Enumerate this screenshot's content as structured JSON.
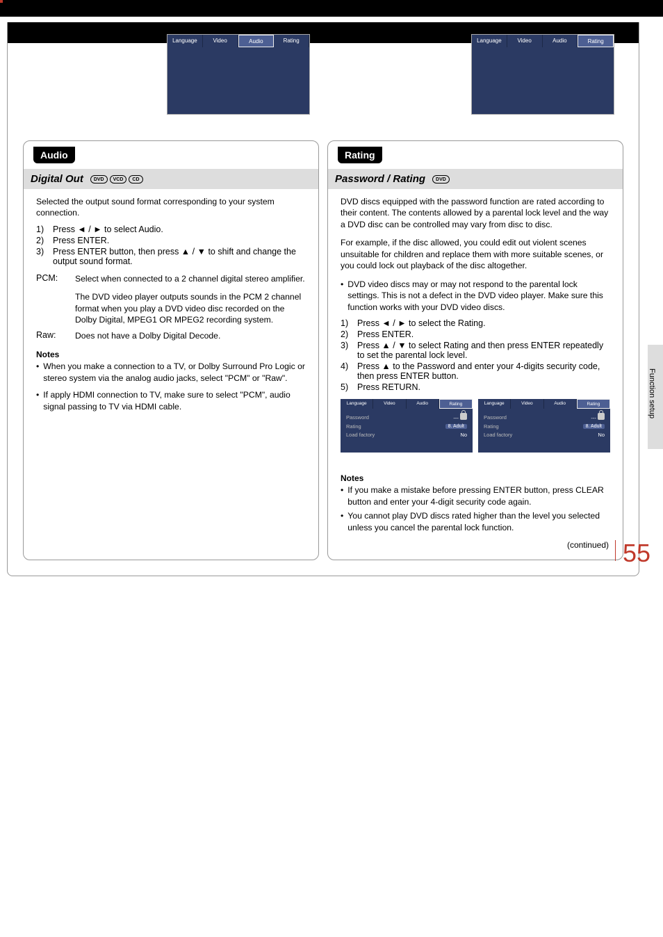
{
  "sideTab": "Function setup",
  "pageNumber": "55",
  "tabs": [
    "Language",
    "Video",
    "Audio",
    "Rating"
  ],
  "left": {
    "sectionTab": "Audio",
    "activeTabIndex": 2,
    "banner": {
      "title": "Digital Out",
      "media": [
        "DVD",
        "VCD",
        "CD"
      ]
    },
    "intro": "Selected the output sound format corresponding to your system connection.",
    "steps": [
      "Press ◄ / ► to select Audio.",
      "Press ENTER.",
      "Press ENTER button, then press ▲ / ▼ to shift and change the output sound format."
    ],
    "kv": [
      {
        "k": "PCM:",
        "v1": "Select when connected to a 2 channel digital stereo amplifier.",
        "v2": "The DVD video player outputs sounds in the PCM 2 channel format when you play a DVD video disc recorded on the Dolby Digital, MPEG1 OR MPEG2 recording system."
      },
      {
        "k": "Raw:",
        "v1": "Does not have a Dolby Digital Decode."
      }
    ],
    "notesTitle": "Notes",
    "notes": [
      "When you make a connection to a TV, or Dolby Surround Pro Logic or stereo system via the analog audio jacks, select \"PCM\" or \"Raw\".",
      "If apply HDMI connection to TV, make sure to select \"PCM\", audio signal passing to TV via HDMI cable."
    ]
  },
  "right": {
    "sectionTab": "Rating",
    "activeTabIndex": 3,
    "banner": {
      "title": "Password / Rating",
      "media": [
        "DVD"
      ]
    },
    "para1": "DVD discs equipped with the password function are rated according to their content. The contents allowed by a parental lock level and the way a DVD disc can be controlled may vary from disc to disc.",
    "para2": "For example, if the disc allowed, you could edit out violent scenes unsuitable for children and replace them with more suitable scenes, or you could lock out playback of the disc altogether.",
    "bullet": "DVD video discs may or may not respond to the parental lock settings. This is not a defect in the DVD video player. Make sure this function works with your DVD video discs.",
    "steps": [
      "Press ◄ / ► to select the Rating.",
      "Press ENTER.",
      "Press ▲ / ▼ to select Rating and then press ENTER repeatedly to set the parental lock level.",
      "Press ▲ to the Password and enter your 4-digits security code, then press ENTER button.",
      "Press RETURN."
    ],
    "osd": {
      "tabs": [
        "Language",
        "Video",
        "Audio",
        "Rating"
      ],
      "activeTabIndex": 3,
      "rows": [
        {
          "label": "Password",
          "value": "---",
          "lock": true
        },
        {
          "label": "Rating",
          "value": "8. Adult",
          "box": true
        },
        {
          "label": "Load factory",
          "value": "No"
        }
      ]
    },
    "notesTitle": "Notes",
    "notes": [
      "If you make a mistake before pressing ENTER button, press CLEAR button and enter your 4-digit security code again.",
      "You cannot play DVD discs rated higher than the level you selected unless you cancel  the parental lock function."
    ],
    "continued": "(continued)"
  }
}
